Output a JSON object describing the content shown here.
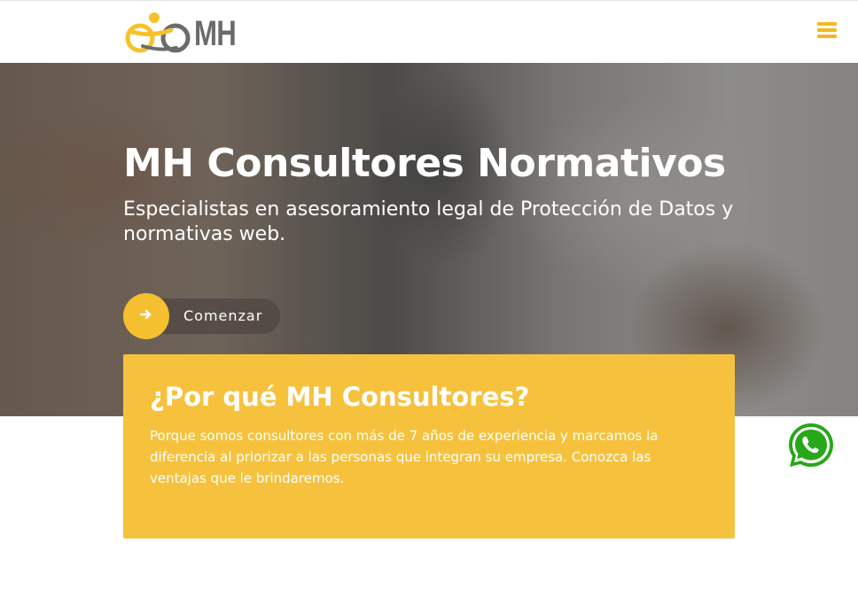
{
  "header": {
    "logo_text": "MH",
    "menu_icon": "hamburger-menu-icon"
  },
  "hero": {
    "title": "MH Consultores Normativos",
    "subtitle": "Especialistas en asesoramiento legal de Protección de Datos y normativas web.",
    "cta_label": "Comenzar",
    "cta_icon": "arrow-right-icon"
  },
  "why": {
    "title": "¿Por qué MH Consultores?",
    "text": "Porque somos consultores con más de 7 años de experiencia y marcamos la diferencia al priorizar a las personas que integran su empresa. Conozca las ventajas que le brindaremos."
  },
  "whatsapp": {
    "icon": "whatsapp-icon"
  },
  "colors": {
    "accent": "#f6c23e",
    "logo_gray": "#6b6b6b",
    "whatsapp_green": "#25d366"
  }
}
